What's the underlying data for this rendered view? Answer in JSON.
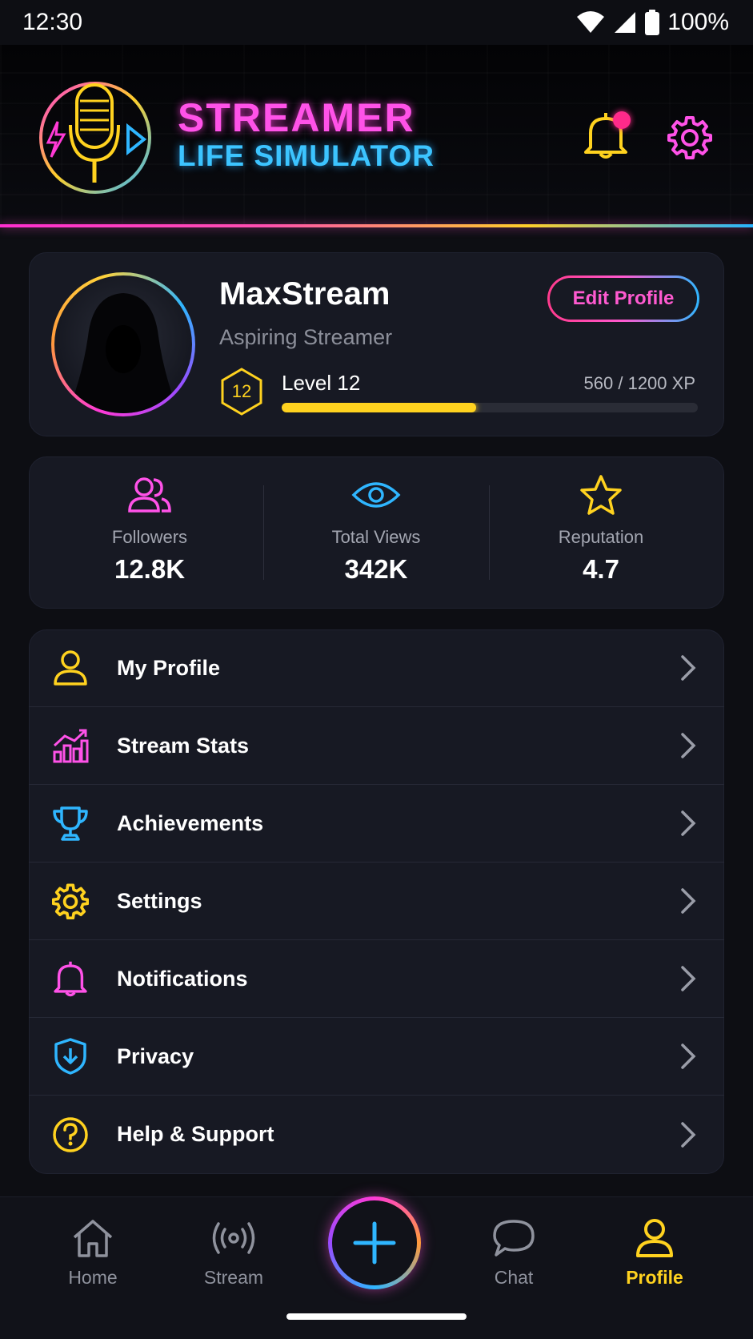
{
  "status_bar": {
    "time": "12:30",
    "battery": "100%"
  },
  "header": {
    "title_line1": "STREAMER",
    "title_line2": "LIFE SIMULATOR",
    "colors": {
      "accent_pink": "#ff52e8",
      "accent_blue": "#3cc4ff",
      "accent_yellow": "#ffd21f"
    }
  },
  "profile": {
    "username": "MaxStream",
    "title": "Aspiring Streamer",
    "edit_label": "Edit Profile",
    "level_number": "12",
    "level_label": "Level 12",
    "xp_text": "560 / 1200 XP",
    "xp_fraction": 0.4667
  },
  "stats": [
    {
      "label": "Followers",
      "value": "12.8K",
      "icon": "users-icon"
    },
    {
      "label": "Total Views",
      "value": "342K",
      "icon": "eye-icon"
    },
    {
      "label": "Reputation",
      "value": "4.7",
      "icon": "star-icon"
    }
  ],
  "menu": [
    {
      "label": "My Profile",
      "icon": "user-icon"
    },
    {
      "label": "Stream Stats",
      "icon": "stats-chart-icon"
    },
    {
      "label": "Achievements",
      "icon": "trophy-icon"
    },
    {
      "label": "Settings",
      "icon": "gear-icon"
    },
    {
      "label": "Notifications",
      "icon": "bell-icon"
    },
    {
      "label": "Privacy",
      "icon": "shield-icon"
    },
    {
      "label": "Help & Support",
      "icon": "help-icon"
    }
  ],
  "nav": {
    "home": "Home",
    "stream": "Stream",
    "chat": "Chat",
    "profile": "Profile",
    "active": "Profile"
  }
}
